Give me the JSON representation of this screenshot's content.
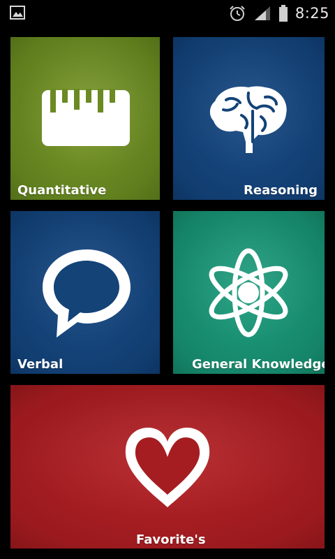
{
  "status_bar": {
    "time": "8:25",
    "icons": [
      "image-icon",
      "alarm-icon",
      "signal-icon",
      "battery-icon"
    ]
  },
  "tiles": {
    "quantitative": {
      "label": "Quantitative",
      "icon": "ruler-icon",
      "color": "#6b8a22"
    },
    "reasoning": {
      "label": "Reasoning",
      "icon": "brain-icon",
      "color": "#134377"
    },
    "verbal": {
      "label": "Verbal",
      "icon": "speech-bubble-icon",
      "color": "#134377"
    },
    "general_knowledge": {
      "label": "General Knowledge",
      "icon": "atom-icon",
      "color": "#178c6f"
    },
    "favorites": {
      "label": "Favorite's",
      "icon": "heart-icon",
      "color": "#a51d21"
    }
  }
}
